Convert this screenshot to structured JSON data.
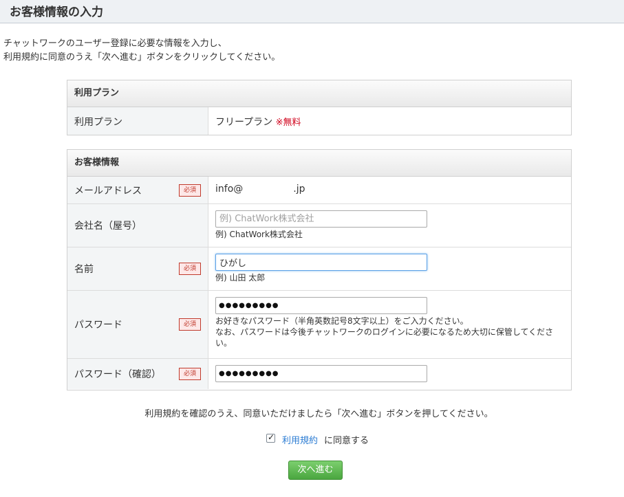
{
  "page": {
    "title": "お客様情報の入力",
    "intro_line1": "チャットワークのユーザー登録に必要な情報を入力し、",
    "intro_line2": "利用規約に同意のうえ「次へ進む」ボタンをクリックしてください。"
  },
  "plan_section": {
    "header": "利用プラン",
    "row_label": "利用プラン",
    "plan_name": "フリープラン",
    "free_note": "※無料"
  },
  "customer_section": {
    "header": "お客様情報",
    "required_label": "必須",
    "email": {
      "label": "メールアドレス",
      "value_prefix": "info@",
      "value_suffix": ".jp"
    },
    "company": {
      "label": "会社名（屋号）",
      "placeholder": "例) ChatWork株式会社",
      "value": "",
      "hint": "例) ChatWork株式会社"
    },
    "name": {
      "label": "名前",
      "value": "ひがし",
      "hint": "例) 山田 太郎"
    },
    "password": {
      "label": "パスワード",
      "masked_value": "●●●●●●●●●",
      "hint_line1": "お好きなパスワード（半角英数記号8文字以上）をご入力ください。",
      "hint_line2": "なお、パスワードは今後チャットワークのログインに必要になるため大切に保管してください。"
    },
    "password_confirm": {
      "label": "パスワード（確認）",
      "masked_value": "●●●●●●●●●"
    }
  },
  "footer": {
    "confirm_text": "利用規約を確認のうえ、同意いただけましたら「次へ進む」ボタンを押してください。",
    "terms_link": "利用規約",
    "agree_label": "に同意する",
    "agree_checked": true,
    "next_button": "次へ進む"
  },
  "colors": {
    "accent_green": "#4aa63f",
    "required_red": "#c0392b",
    "link_blue": "#2b7cd3",
    "free_red": "#d0021b"
  }
}
